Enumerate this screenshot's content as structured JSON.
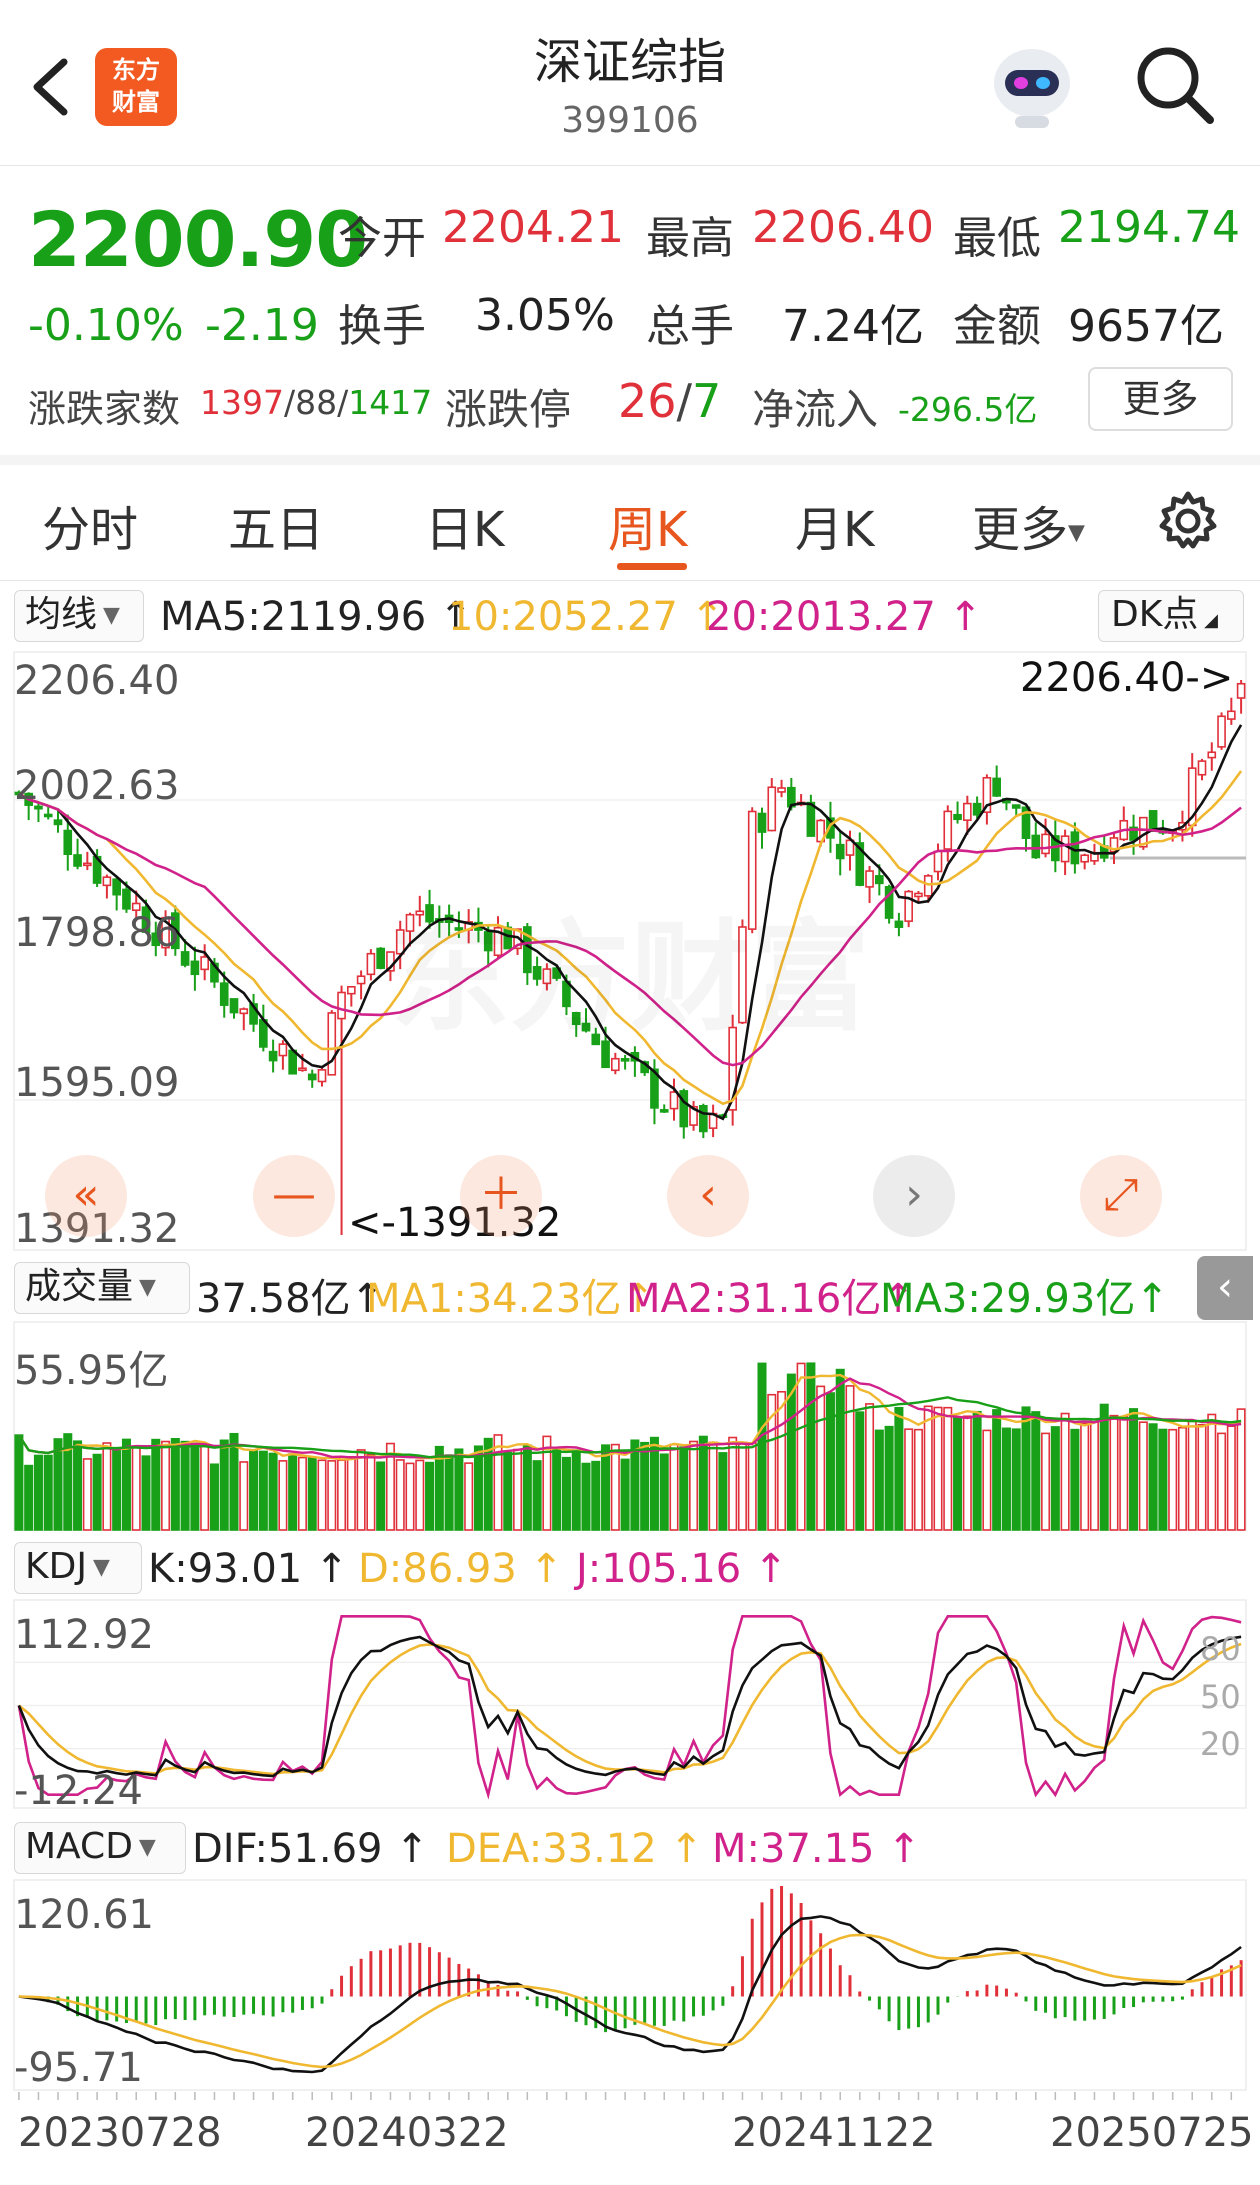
{
  "header": {
    "title": "深证综指",
    "code": "399106",
    "logo_line1": "东方",
    "logo_line2": "财富"
  },
  "quote": {
    "price": "2200.90",
    "change_pct": "-0.10%",
    "change_abs": "-2.19",
    "open_label": "今开",
    "open": "2204.21",
    "high_label": "最高",
    "high": "2206.40",
    "low_label": "最低",
    "low": "2194.74",
    "turnover_label": "换手",
    "turnover": "3.05%",
    "volume_label": "总手",
    "volume": "7.24亿",
    "amount_label": "金额",
    "amount": "9657亿",
    "breadth_label": "涨跌家数",
    "breadth_up": "1397",
    "breadth_flat": "88",
    "breadth_down": "1417",
    "limit_label": "涨跌停",
    "limit_up": "26",
    "limit_down": "7",
    "netflow_label": "净流入",
    "netflow": "-296.5亿",
    "more_label": "更多"
  },
  "tabs": [
    "分时",
    "五日",
    "日K",
    "周K",
    "月K",
    "更多"
  ],
  "active_tab": "周K",
  "kline": {
    "ma_select": "均线",
    "ma5": "MA5:2119.96",
    "ma10": "10:2052.27",
    "ma20": "20:2013.27",
    "dk_label": "DK点",
    "axis": [
      "2206.40",
      "2002.63",
      "1798.86",
      "1595.09",
      "1391.32"
    ],
    "high_marker": "2206.40->",
    "low_marker": "<-1391.32",
    "watermark": "东方财富"
  },
  "volume": {
    "select": "成交量",
    "value": "37.58亿",
    "ma1": "MA1:34.23亿",
    "ma2": "MA2:31.16亿",
    "ma3": "MA3:29.93亿",
    "axis_max": "55.95亿"
  },
  "kdj": {
    "select": "KDJ",
    "k": "K:93.01",
    "d": "D:86.93",
    "j": "J:105.16",
    "axis_top": "112.92",
    "axis_bottom": "-12.24",
    "ref": [
      "80",
      "50",
      "20"
    ]
  },
  "macd": {
    "select": "MACD",
    "dif": "DIF:51.69",
    "dea": "DEA:33.12",
    "m": "M:37.15",
    "axis_top": "120.61",
    "axis_bottom": "-95.71"
  },
  "dates": [
    "20230728",
    "20240322",
    "20241122",
    "20250725"
  ],
  "colors": {
    "up": "#e0303a",
    "down": "#18a018",
    "ma5": "#111111",
    "ma10": "#f0b830",
    "ma20": "#d0228a",
    "accent": "#e8561f"
  },
  "chart_data": [
    {
      "type": "candlestick",
      "title": "",
      "ylim": [
        1391.32,
        2206.4
      ],
      "n_weeks": 126,
      "anchors": {
        "weeks": [
          0,
          10,
          20,
          30,
          33,
          40,
          50,
          60,
          70,
          72,
          75,
          78,
          85,
          90,
          95,
          100,
          104,
          110,
          112,
          118,
          126
        ],
        "close": [
          2040,
          1900,
          1760,
          1620,
          1740,
          1860,
          1830,
          1660,
          1540,
          1560,
          1990,
          2050,
          1950,
          1870,
          1990,
          2060,
          1950,
          1960,
          1990,
          2000,
          2200
        ]
      }
    },
    {
      "type": "bar",
      "title": "成交量",
      "ylim": [
        0,
        55.95
      ],
      "last_value": 37.58
    }
  ]
}
